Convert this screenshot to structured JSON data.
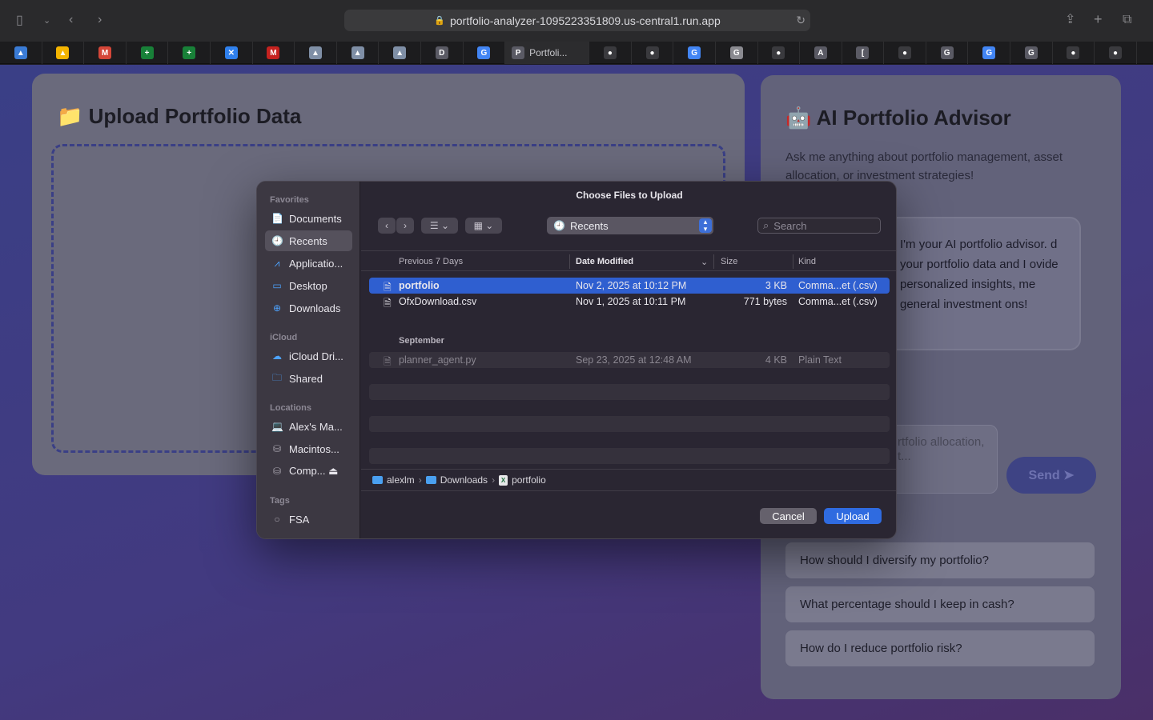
{
  "browser": {
    "url": "portfolio-analyzer-1095223351809.us-central1.run.app",
    "active_tab_title": "Portfoli...",
    "tabs": [
      {
        "icon": "google-drive-icon",
        "glyph": "▲",
        "color": "#3a7bd5"
      },
      {
        "icon": "google-drive-icon",
        "glyph": "▲",
        "color": "#f4b400"
      },
      {
        "icon": "gmail-icon",
        "glyph": "M",
        "color": "#d44638"
      },
      {
        "icon": "google-sheets-icon",
        "glyph": "+",
        "color": "#188038"
      },
      {
        "icon": "google-sheets-icon",
        "glyph": "+",
        "color": "#188038"
      },
      {
        "icon": "vscode-icon",
        "glyph": "✕",
        "color": "#2f80ed"
      },
      {
        "icon": "gmail-icon",
        "glyph": "M",
        "color": "#c5221f"
      },
      {
        "icon": "google-drive-icon",
        "glyph": "▲",
        "color": "#7f8fa6"
      },
      {
        "icon": "google-drive-icon",
        "glyph": "▲",
        "color": "#7f8fa6"
      },
      {
        "icon": "google-drive-icon",
        "glyph": "▲",
        "color": "#7f8fa6"
      },
      {
        "icon": "d-app-icon",
        "glyph": "D",
        "color": "#5a5a64"
      },
      {
        "icon": "google-icon",
        "glyph": "G",
        "color": "#4285f4"
      },
      {
        "icon": "active-tab",
        "glyph": "P",
        "color": "#5a5a64"
      },
      {
        "icon": "github-icon",
        "glyph": "●",
        "color": "#3a3a3e"
      },
      {
        "icon": "github-icon",
        "glyph": "●",
        "color": "#3a3a3e"
      },
      {
        "icon": "google-icon",
        "glyph": "G",
        "color": "#4285f4"
      },
      {
        "icon": "google-icon",
        "glyph": "G",
        "color": "#8a8a90"
      },
      {
        "icon": "github-icon",
        "glyph": "●",
        "color": "#3a3a3e"
      },
      {
        "icon": "a-app-icon",
        "glyph": "A",
        "color": "#5a5a64"
      },
      {
        "icon": "bracket-app-icon",
        "glyph": "[",
        "color": "#5a5a64"
      },
      {
        "icon": "github-icon",
        "glyph": "●",
        "color": "#3a3a3e"
      },
      {
        "icon": "g-app-icon",
        "glyph": "G",
        "color": "#5a5a64"
      },
      {
        "icon": "google-icon",
        "glyph": "G",
        "color": "#4285f4"
      },
      {
        "icon": "g-app-icon",
        "glyph": "G",
        "color": "#5a5a64"
      },
      {
        "icon": "github-icon",
        "glyph": "●",
        "color": "#3a3a3e"
      },
      {
        "icon": "github-icon",
        "glyph": "●",
        "color": "#3a3a3e"
      }
    ]
  },
  "upload_card": {
    "title": "📁 Upload Portfolio Data"
  },
  "advisor_card": {
    "title": "🤖 AI Portfolio Advisor",
    "description": "Ask me anything about portfolio management, asset allocation, or investment strategies!",
    "bubble_text": "I'm your AI portfolio advisor. d your portfolio data and I ovide personalized insights, me general investment ons!",
    "input_placeholder": "rtfolio allocation, t...",
    "send_label": "Send ➤",
    "suggestions": [
      "How should I diversify my portfolio?",
      "What percentage should I keep in cash?",
      "How do I reduce portfolio risk?"
    ]
  },
  "dialog": {
    "title": "Choose Files to Upload",
    "location": "Recents",
    "search_placeholder": "Search",
    "sidebar": {
      "favorites_label": "Favorites",
      "favorites": [
        {
          "label": "Documents",
          "icon": "📄"
        },
        {
          "label": "Recents",
          "icon": "🕘"
        },
        {
          "label": "Applicatio...",
          "icon": "⩘"
        },
        {
          "label": "Desktop",
          "icon": "▭"
        },
        {
          "label": "Downloads",
          "icon": "⊕"
        }
      ],
      "icloud_label": "iCloud",
      "icloud": [
        {
          "label": "iCloud Dri...",
          "icon": "☁"
        },
        {
          "label": "Shared",
          "icon": "🗀"
        }
      ],
      "locations_label": "Locations",
      "locations": [
        {
          "label": "Alex's Ma...",
          "icon": "💻"
        },
        {
          "label": "Macintos...",
          "icon": "⛁"
        },
        {
          "label": "Comp... ⏏",
          "icon": "⛁"
        }
      ],
      "tags_label": "Tags",
      "tags": [
        {
          "label": "FSA",
          "icon": "○"
        }
      ]
    },
    "columns": {
      "name": "Previous 7 Days",
      "date": "Date Modified",
      "size": "Size",
      "kind": "Kind"
    },
    "recent_files": [
      {
        "name": "portfolio",
        "date": "Nov 2, 2025 at 10:12 PM",
        "size": "3 KB",
        "kind": "Comma...et (.csv)"
      },
      {
        "name": "OfxDownload.csv",
        "date": "Nov 1, 2025 at 10:11 PM",
        "size": "771 bytes",
        "kind": "Comma...et (.csv)"
      }
    ],
    "september_label": "September",
    "september_files": [
      {
        "name": "planner_agent.py",
        "date": "Sep 23, 2025 at 12:48 AM",
        "size": "4 KB",
        "kind": "Plain Text"
      }
    ],
    "path": [
      "alexlm",
      "Downloads",
      "portfolio"
    ],
    "cancel_label": "Cancel",
    "upload_label": "Upload"
  }
}
